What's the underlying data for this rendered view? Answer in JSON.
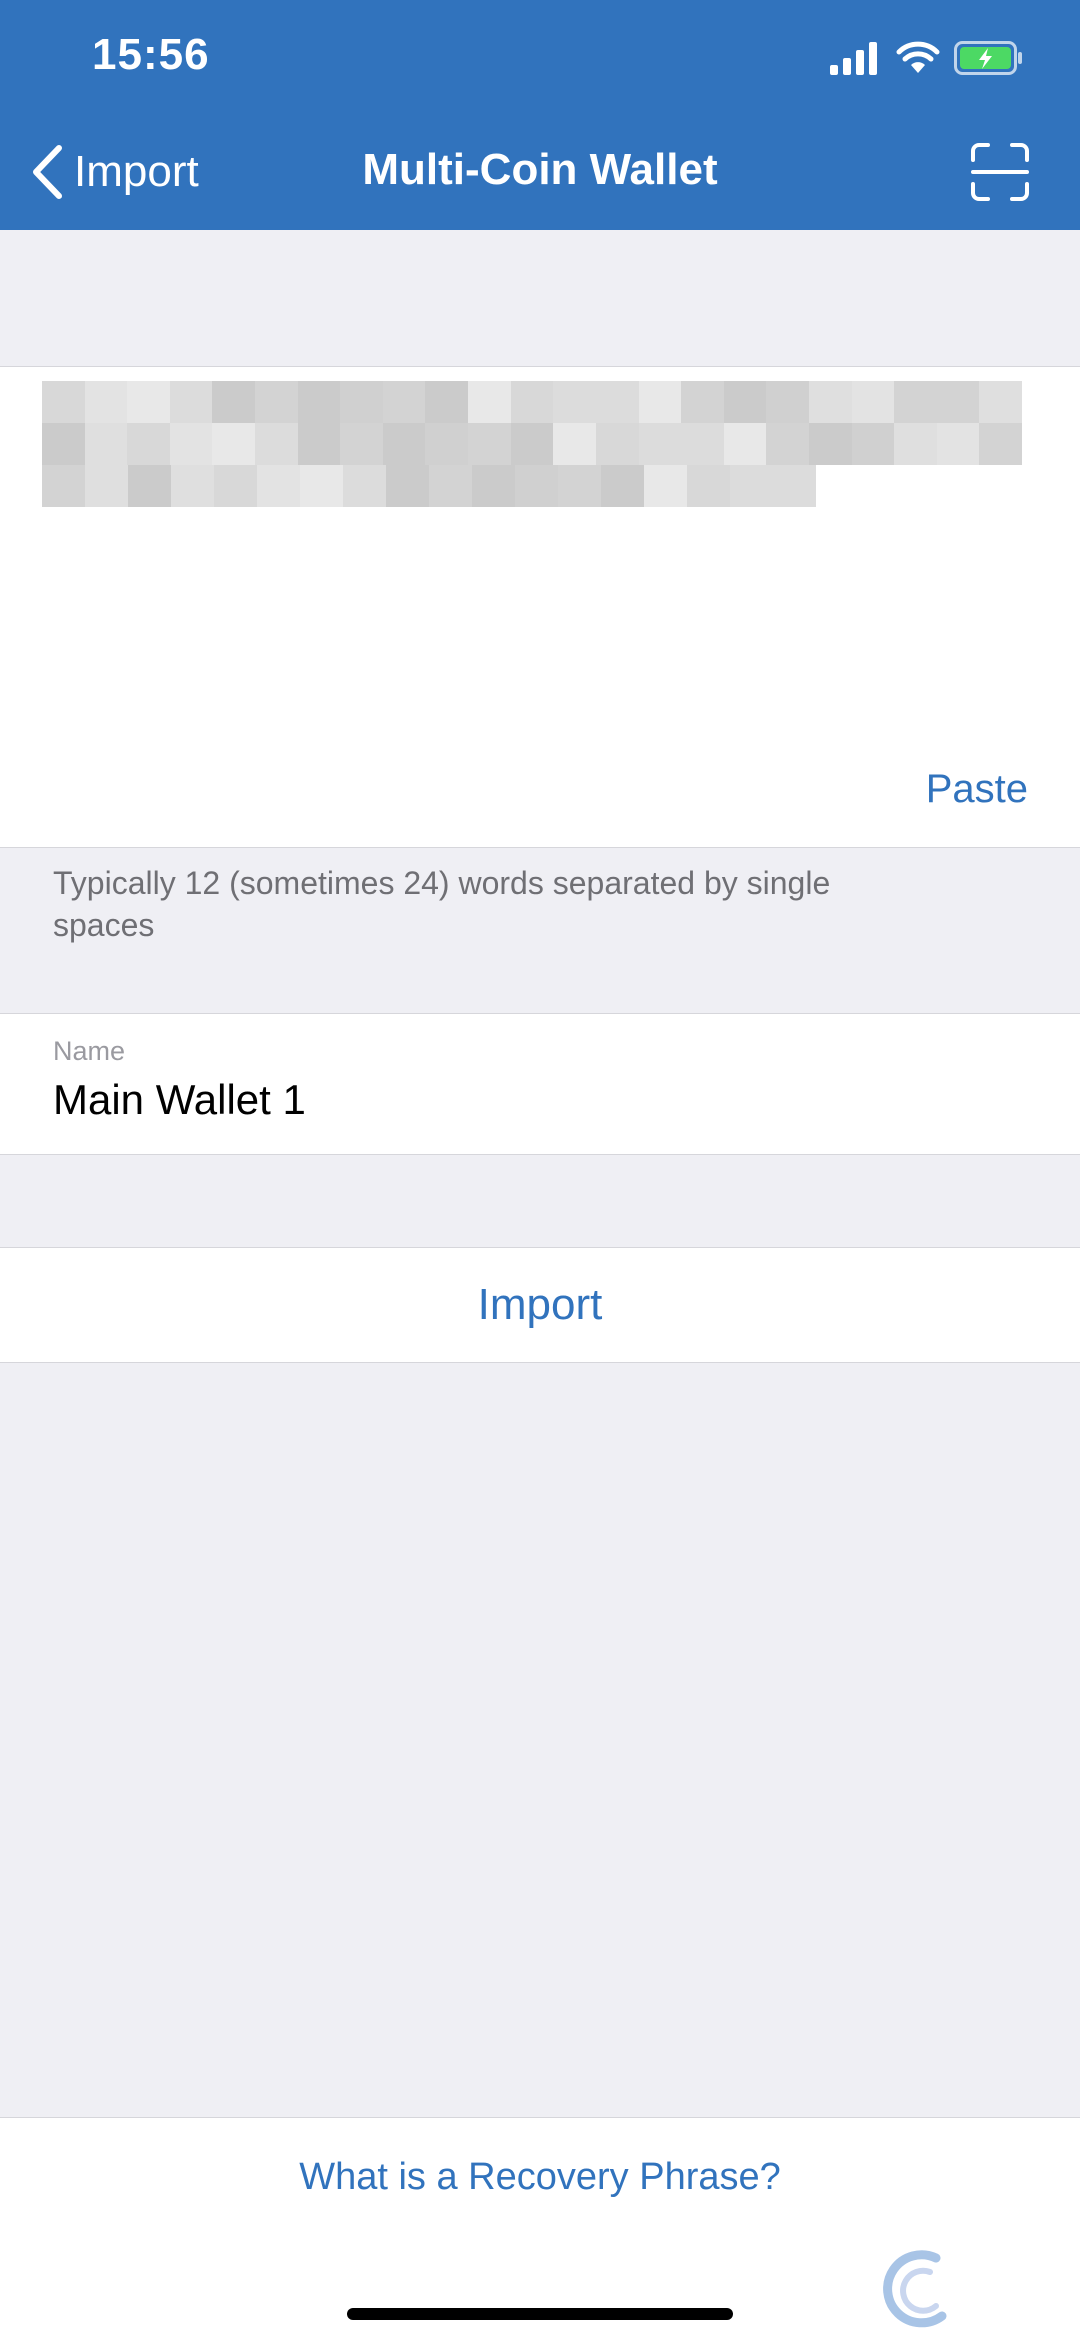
{
  "status_bar": {
    "time": "15:56",
    "icons": [
      "signal-icon",
      "wifi-icon",
      "battery-charging-icon"
    ]
  },
  "nav": {
    "back_label": "Import",
    "title": "Multi-Coin Wallet",
    "scan_icon": "scan-qr-icon"
  },
  "phrase": {
    "paste_label": "Paste",
    "hint": "Typically 12 (sometimes 24) words separated by single spaces"
  },
  "name_field": {
    "label": "Name",
    "value": "Main Wallet 1"
  },
  "import_button": {
    "label": "Import"
  },
  "footer": {
    "recovery_link": "What is a Recovery Phrase?"
  },
  "colors": {
    "accent": "#3173bd",
    "background": "#efeff4",
    "surface": "#ffffff",
    "hint_text": "#6f6f74",
    "battery_green": "#4cd964"
  }
}
